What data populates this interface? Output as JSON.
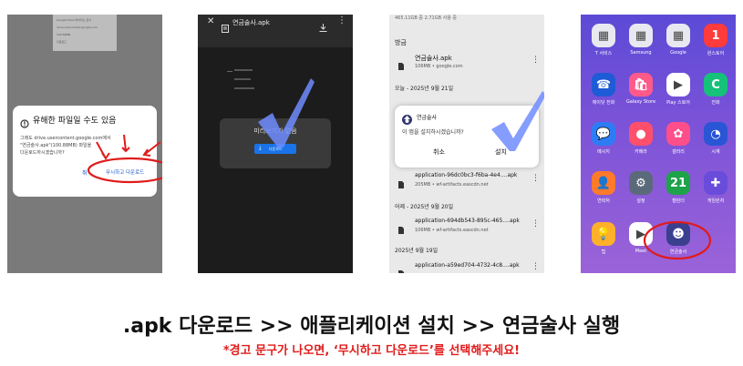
{
  "panel1": {
    "bg_lines": [
      "Google Drive 바이러스 검사",
      "drive.usercontent.google.com",
      "100.88MB",
      "다운로드"
    ],
    "dialog_title": "유해한 파일일 수도 있음",
    "dialog_body1": "그래도 drive.usercontent.google.com에서",
    "dialog_body2": "\"연금술사.apk\"(100.88MB) 파일을",
    "dialog_body3": "다운로드하시겠습니까?",
    "cancel_label": "취",
    "confirm_label": "무시하고 다운로드"
  },
  "panel2": {
    "file_name": "연금술사.apk",
    "card_title": "미리보기가 없음",
    "download_label": "다운로드"
  },
  "panel3": {
    "storage": "465.11GB 중 2.71GB 사용 중",
    "section_recent": "방금",
    "file1_name": "연금술사.apk",
    "file1_meta": "106MB • google.com",
    "section_today": "오늘 - 2025년 9월 21일",
    "dialog_app": "연금술사",
    "dialog_question": "이 앱을 설치하시겠습니까?",
    "cancel_label": "취소",
    "install_label": "설치",
    "file2_name": "application-96dc0bc3-f6ba-4e4....apk",
    "file2_meta": "205MB • wf-artifacts.eascdn.net",
    "section_yesterday": "어제 - 2025년 9월 20일",
    "file3_name": "application-694db543-895c-465....apk",
    "file3_meta": "106MB • wf-artifacts.eascdn.net",
    "section_old": "2025년 9월 19일",
    "file4_name": "application-a59ed704-4732-4c8....apk"
  },
  "panel4": {
    "apps": [
      {
        "label": "T 서비스",
        "color": "#e8e8f0"
      },
      {
        "label": "Samsung",
        "color": "#e8e8f0"
      },
      {
        "label": "Google",
        "color": "#e8e8f0"
      },
      {
        "label": "원스토어",
        "color": "#ff3b3b"
      },
      {
        "label": "에이닷 전화",
        "color": "#1e5bd6"
      },
      {
        "label": "Galaxy Store",
        "color": "#ff5a8a"
      },
      {
        "label": "Play 스토어",
        "color": "#ffffff"
      },
      {
        "label": "전화",
        "color": "#16c17a"
      },
      {
        "label": "메시지",
        "color": "#2d7cf6"
      },
      {
        "label": "카메라",
        "color": "#ff4f6b"
      },
      {
        "label": "갤러리",
        "color": "#ff4f8a"
      },
      {
        "label": "시계",
        "color": "#2a56d6"
      },
      {
        "label": "연락처",
        "color": "#ff7a2a"
      },
      {
        "label": "설정",
        "color": "#5b6a7a"
      },
      {
        "label": "캘린더",
        "color": "#1ea24a"
      },
      {
        "label": "게임런처",
        "color": "#6a4cdb"
      },
      {
        "label": "팁",
        "color": "#ffb02a"
      },
      {
        "label": "Meet",
        "color": "#ffffff"
      },
      {
        "label": "연금술사",
        "color": "#3b3f8f"
      }
    ],
    "calendar_day": "21",
    "onestore_glyph": "1"
  },
  "headline": ".apk 다운로드 >> 애플리케이션 설치 >> 연금술사 실행",
  "subline": "*경고 문구가 나오면, ‘무시하고 다운로드’를 선택해주세요!",
  "colors": {
    "accent_red": "#e01b1b",
    "check_blue": "#6f8cff",
    "button_blue": "#1a73e8"
  }
}
